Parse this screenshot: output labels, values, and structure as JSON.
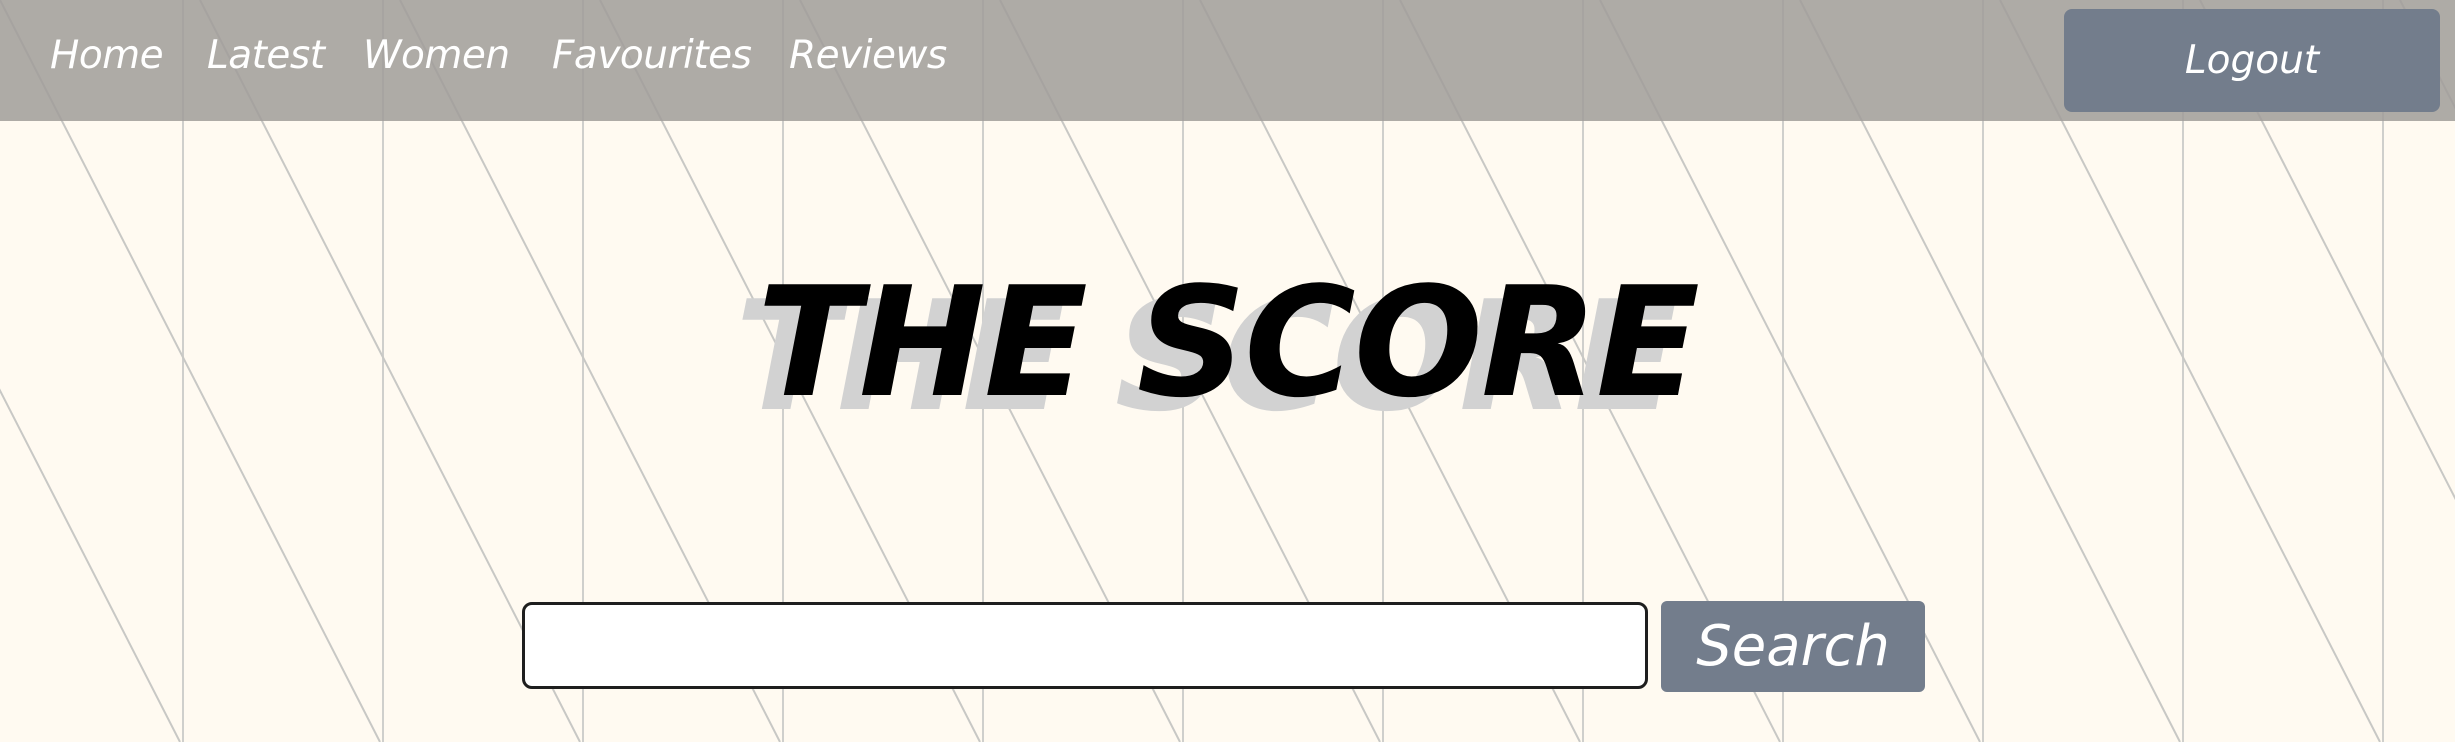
{
  "nav": {
    "items": [
      {
        "label": "Home"
      },
      {
        "label": "Latest"
      },
      {
        "label": "Women"
      },
      {
        "label": "Favourites"
      },
      {
        "label": "Reviews"
      }
    ],
    "logout_label": "Logout"
  },
  "hero": {
    "title": "THE SCORE"
  },
  "search": {
    "value": "",
    "placeholder": "",
    "button_label": "Search"
  },
  "colors": {
    "background": "#fffaf1",
    "navbar": "#a09c99",
    "button": "#737d8c",
    "title": "#000000",
    "title_shadow": "#d2d2d2"
  }
}
